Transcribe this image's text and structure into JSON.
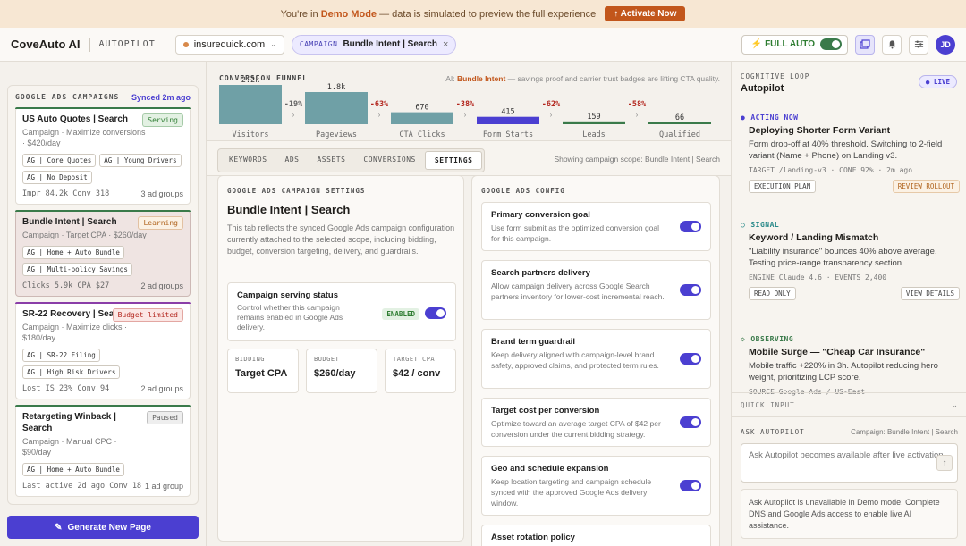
{
  "banner": {
    "prefix": "You're in",
    "mode": "Demo Mode",
    "suffix": "— data is simulated to preview the full experience",
    "activate_label": "↑ Activate Now"
  },
  "header": {
    "brand": "CoveAuto AI",
    "sub": "AUTOPILOT",
    "domain": "insurequick.com",
    "campaign_tag": "CAMPAIGN",
    "campaign_name": "Bundle Intent | Search",
    "full_auto_label": "⚡ FULL AUTO",
    "avatar_initials": "JD"
  },
  "sidebar": {
    "title": "GOOGLE ADS CAMPAIGNS",
    "synced": "Synced 2m ago",
    "campaigns": [
      {
        "name": "US Auto Quotes | Search",
        "meta": "Campaign · Maximize conversions · $420/day",
        "badge": "Serving",
        "badge_fg": "#2e7d32",
        "badge_bg": "#e3f1e3",
        "bar": "#3a7a4a",
        "tags": [
          "AG | Core Quotes",
          "AG | Young Drivers",
          "AG | No Deposit"
        ],
        "metrics": "Impr 84.2k Conv 318",
        "groups": "3 ad groups"
      },
      {
        "name": "Bundle Intent | Search",
        "meta": "Campaign · Target CPA · $260/day",
        "badge": "Learning",
        "badge_fg": "#b0641e",
        "badge_bg": "#fbf1e4",
        "bar": "#3a7a4a",
        "tags": [
          "AG | Home + Auto Bundle",
          "AG | Multi-policy Savings"
        ],
        "metrics": "Clicks 5.9k CPA $27",
        "groups": "2 ad groups"
      },
      {
        "name": "SR-22 Recovery | Search",
        "meta": "Campaign · Maximize clicks · $180/day",
        "badge": "Budget limited",
        "badge_fg": "#b3261e",
        "badge_bg": "#fbe7e5",
        "bar": "#8a3ea8",
        "tags": [
          "AG | SR-22 Filing",
          "AG | High Risk Drivers"
        ],
        "metrics": "Lost IS 23% Conv 94",
        "groups": "2 ad groups"
      },
      {
        "name": "Retargeting Winback | Search",
        "meta": "Campaign · Manual CPC · $90/day",
        "badge": "Paused",
        "badge_fg": "#666666",
        "badge_bg": "#eeeeee",
        "bar": "#3a7a4a",
        "tags": [
          "AG | Home + Auto Bundle"
        ],
        "metrics": "Last active 2d ago Conv 18",
        "groups": "1 ad group"
      }
    ],
    "generate_label": "Generate New Page"
  },
  "funnel": {
    "title": "CONVERSION FUNNEL",
    "note_prefix": "AI:",
    "note_bold": "Bundle Intent",
    "note_suffix": "— savings proof and carrier trust badges are lifting CTA quality."
  },
  "chart_data": {
    "type": "bar",
    "title": "CONVERSION FUNNEL",
    "categories": [
      "Visitors",
      "Pageviews",
      "CTA Clicks",
      "Form Starts",
      "Leads",
      "Qualified"
    ],
    "values": [
      2200,
      1800,
      670,
      415,
      159,
      66
    ],
    "value_labels": [
      "2.2k",
      "1.8k",
      "670",
      "415",
      "159",
      "66"
    ],
    "drop_labels": [
      "-19%",
      "-63%",
      "-38%",
      "-62%",
      "-58%"
    ],
    "colors": [
      "#6fa0a6",
      "#6fa0a6",
      "#6fa0a6",
      "#4b3fd1",
      "#3a7a4a",
      "#3a7a4a"
    ],
    "drop_colors": [
      "#666666",
      "#b3261e",
      "#b3261e",
      "#b3261e",
      "#b3261e"
    ]
  },
  "tabs": [
    {
      "label": "KEYWORDS",
      "active": false
    },
    {
      "label": "ADS",
      "active": false
    },
    {
      "label": "ASSETS",
      "active": false
    },
    {
      "label": "CONVERSIONS",
      "active": false
    },
    {
      "label": "SETTINGS",
      "active": true
    }
  ],
  "scope_note": "Showing campaign scope: Bundle Intent | Search",
  "settings": {
    "label": "GOOGLE ADS CAMPAIGN SETTINGS",
    "title": "Bundle Intent | Search",
    "desc": "This tab reflects the synced Google Ads campaign configuration currently attached to the selected scope, including bidding, budget, conversion targeting, delivery, and guardrails.",
    "serving_title": "Campaign serving status",
    "serving_desc": "Control whether this campaign remains enabled in Google Ads delivery.",
    "serving_badge": "ENABLED",
    "kpis": [
      {
        "label": "BIDDING",
        "value": "Target CPA"
      },
      {
        "label": "BUDGET",
        "value": "$260/day"
      },
      {
        "label": "TARGET CPA",
        "value": "$42 / conv"
      }
    ]
  },
  "config": {
    "label": "GOOGLE ADS CONFIG",
    "items": [
      {
        "title": "Primary conversion goal",
        "desc": "Use form submit as the optimized conversion goal for this campaign."
      },
      {
        "title": "Search partners delivery",
        "desc": "Allow campaign delivery across Google Search partners inventory for lower-cost incremental reach."
      },
      {
        "title": "Brand term guardrail",
        "desc": "Keep delivery aligned with campaign-level brand safety, approved claims, and protected term rules."
      },
      {
        "title": "Target cost per conversion",
        "desc": "Optimize toward an average target CPA of $42 per conversion under the current bidding strategy."
      },
      {
        "title": "Geo and schedule expansion",
        "desc": "Keep location targeting and campaign schedule synced with the approved Google Ads delivery window."
      },
      {
        "title": "Asset rotation policy",
        "desc": ""
      }
    ]
  },
  "right": {
    "label": "COGNITIVE LOOP",
    "title": "Autopilot",
    "live": "● LIVE",
    "events": [
      {
        "status": "ACTING NOW",
        "marker": "●",
        "color": "#4b3fd1",
        "title": "Deploying Shorter Form Variant",
        "desc": "Form drop-off at 40% threshold. Switching to 2-field variant (Name + Phone) on Landing v3.",
        "meta": "TARGET /landing-v3 · CONF 92% · 2m ago",
        "act_left": "EXECUTION PLAN",
        "act_right": "REVIEW ROLLOUT"
      },
      {
        "status": "SIGNAL",
        "marker": "○",
        "color": "#2a8a8a",
        "title": "Keyword / Landing Mismatch",
        "desc": "\"Liability insurance\" bounces 40% above average. Testing price-range transparency section.",
        "meta": "ENGINE Claude 4.6 · EVENTS 2,400",
        "act_left": "READ ONLY",
        "act_right": "VIEW DETAILS"
      },
      {
        "status": "OBSERVING",
        "marker": "◇",
        "color": "#3a7a4a",
        "title": "Mobile Surge — \"Cheap Car Insurance\"",
        "desc": "Mobile traffic +220% in 3h. Autopilot reducing hero weight, prioritizing LCP score.",
        "meta": "SOURCE Google Ads / US-East",
        "act_left": "",
        "act_right": ""
      }
    ],
    "quick_input": "QUICK INPUT",
    "ask_label": "ASK AUTOPILOT",
    "ask_scope": "Campaign: Bundle Intent | Search",
    "ask_placeholder": "Ask Autopilot becomes available after live activation.",
    "ask_warning": "Ask Autopilot is unavailable in Demo mode. Complete DNS and Google Ads access to enable live AI assistance."
  }
}
